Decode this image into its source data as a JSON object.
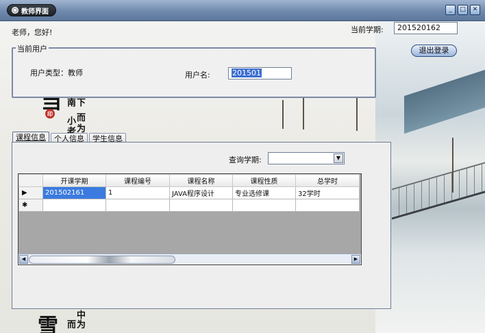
{
  "window": {
    "title": "教师界面",
    "controls": [
      "minimize-icon",
      "restore-icon",
      "close-icon"
    ]
  },
  "header": {
    "greeting": "老师，您好!",
    "current_term_label": "当前学期:",
    "current_term_value": "201520162",
    "logout_label": "退出登录"
  },
  "current_user": {
    "legend": "当前用户",
    "user_type_label": "用户类型：",
    "user_type_value": "教师",
    "username_label": "用户名:",
    "username_value": "201501"
  },
  "background_text": {
    "top": [
      "当",
      "南",
      "下",
      "小",
      "而",
      "老",
      "为"
    ],
    "bottom": [
      "中",
      "而",
      "为"
    ]
  },
  "tabs": [
    {
      "label": "课程信息",
      "active": true
    },
    {
      "label": "个人信息",
      "active": false
    },
    {
      "label": "学生信息",
      "active": false
    }
  ],
  "query": {
    "label": "查询学期:",
    "selected": ""
  },
  "grid": {
    "columns": [
      "开课学期",
      "课程编号",
      "课程名称",
      "课程性质",
      "总学时"
    ],
    "rows": [
      {
        "marker": "▶",
        "cells": [
          "201502161",
          "1",
          "JAVA程序设计",
          "专业选修课",
          "32学时"
        ]
      },
      {
        "marker": "✱",
        "cells": [
          "",
          "",
          "",
          "",
          ""
        ]
      }
    ]
  },
  "colors": {
    "titlebar": "#6f89ad",
    "selection": "#3b7be0",
    "grid_empty": "#a7a7a7"
  }
}
